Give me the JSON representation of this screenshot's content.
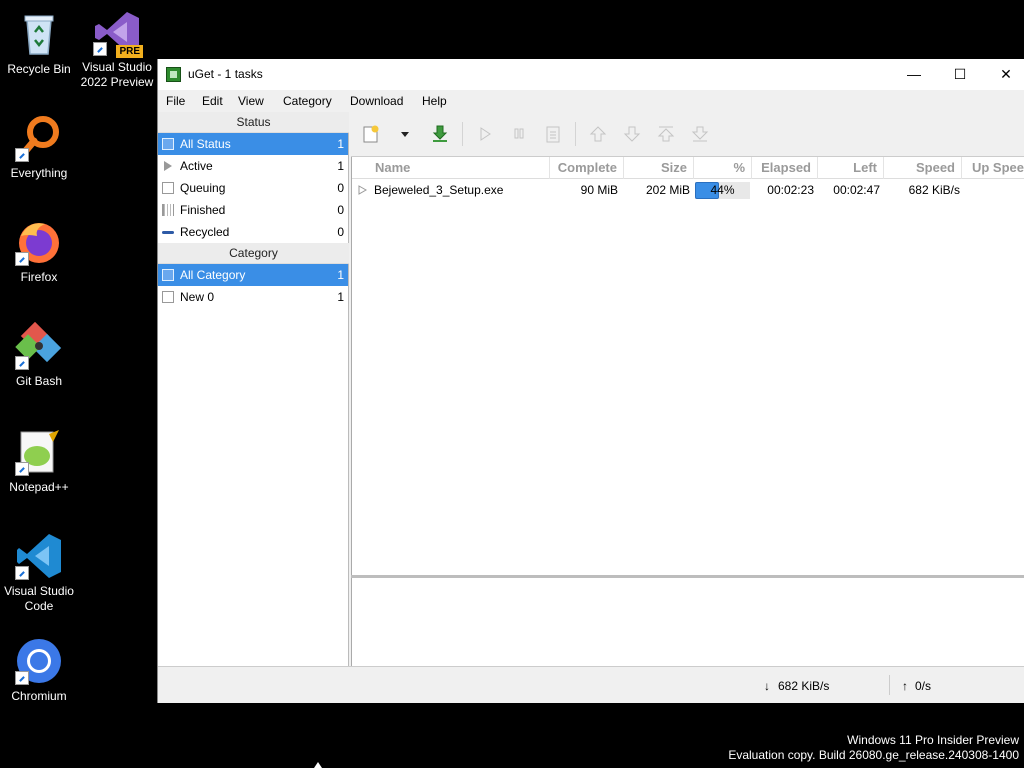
{
  "desktop": {
    "icons": [
      {
        "label": "Recycle Bin"
      },
      {
        "label": "Visual Studio 2022 Preview",
        "badge": "PRE"
      },
      {
        "label": "Everything"
      },
      {
        "label": "Firefox"
      },
      {
        "label": "Git Bash"
      },
      {
        "label": "Notepad++"
      },
      {
        "label": "Visual Studio Code"
      },
      {
        "label": "Chromium"
      }
    ],
    "watermark": {
      "line1": "Windows 11 Pro Insider Preview",
      "line2": "Evaluation copy. Build 26080.ge_release.240308-1400"
    }
  },
  "window": {
    "title": "uGet - 1 tasks",
    "controls": {
      "minimize": "—",
      "maximize": "☐",
      "close": "✕"
    },
    "menu": [
      "File",
      "Edit",
      "View",
      "Category",
      "Download",
      "Help"
    ]
  },
  "sidebar": {
    "status_header": "Status",
    "status_items": [
      {
        "label": "All Status",
        "count": "1",
        "selected": true
      },
      {
        "label": "Active",
        "count": "1"
      },
      {
        "label": "Queuing",
        "count": "0"
      },
      {
        "label": "Finished",
        "count": "0"
      },
      {
        "label": "Recycled",
        "count": "0"
      }
    ],
    "category_header": "Category",
    "category_items": [
      {
        "label": "All Category",
        "count": "1",
        "selected": true
      },
      {
        "label": "New 0",
        "count": "1"
      }
    ]
  },
  "list": {
    "columns": [
      "Name",
      "Complete",
      "Size",
      "%",
      "Elapsed",
      "Left",
      "Speed",
      "Up Spee"
    ],
    "rows": [
      {
        "name": "Bejeweled_3_Setup.exe",
        "complete": "90 MiB",
        "size": "202 MiB",
        "percent_label": "44%",
        "progress": 0.44,
        "elapsed": "00:02:23",
        "left": "00:02:47",
        "speed": "682 KiB/s",
        "up_speed": ""
      }
    ]
  },
  "statusbar": {
    "down_arrow": "↓",
    "down_speed": "682 KiB/s",
    "up_arrow": "↑",
    "up_speed": "0/s"
  },
  "colors": {
    "selection": "#3a8ee6",
    "window_bg": "#f0f0f0",
    "desktop_bg": "#000000"
  }
}
